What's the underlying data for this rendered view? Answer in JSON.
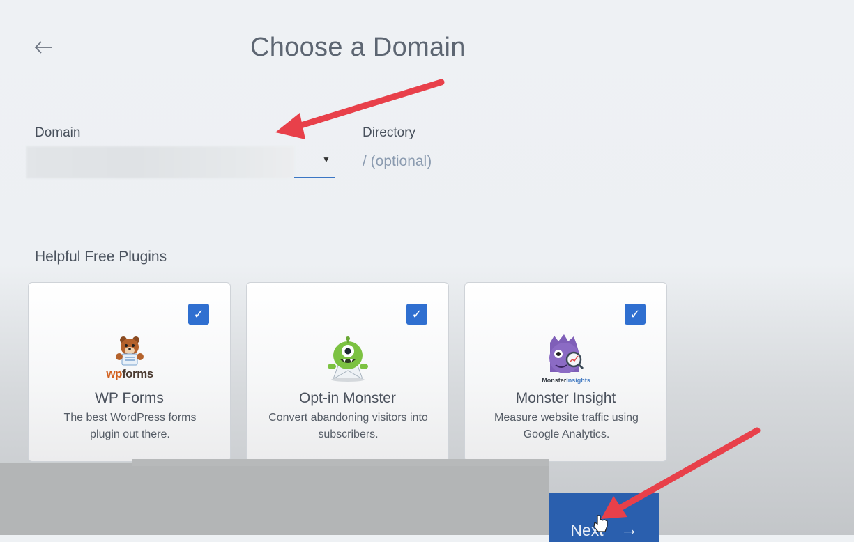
{
  "header": {
    "title": "Choose a Domain"
  },
  "form": {
    "domain_label": "Domain",
    "directory_label": "Directory",
    "directory_placeholder": "/ (optional)"
  },
  "plugins": {
    "heading": "Helpful Free Plugins",
    "items": [
      {
        "name": "WP Forms",
        "description": "The best WordPress forms plugin out there.",
        "logo_text": "wpforms",
        "checked": true
      },
      {
        "name": "Opt-in Monster",
        "description": "Convert abandoning visitors into subscribers.",
        "checked": true
      },
      {
        "name": "Monster Insight",
        "description": "Measure website traffic using Google Analytics.",
        "logo_text": "MonsterInsights",
        "checked": true
      }
    ]
  },
  "footer": {
    "next_label": "Next"
  },
  "colors": {
    "accent": "#2f6fd0",
    "button": "#2a5fae",
    "annotation_arrow": "#e8404a"
  }
}
